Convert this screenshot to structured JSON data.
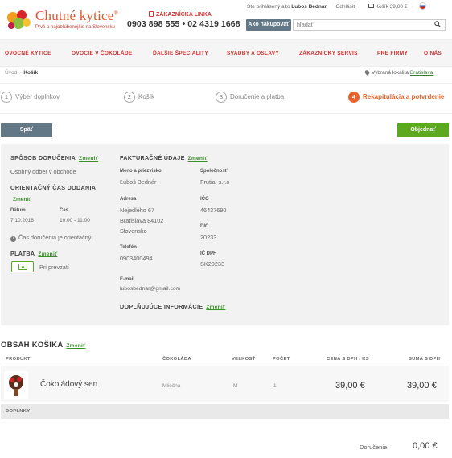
{
  "header": {
    "logo_name": "Chutné kytice",
    "logo_reg": "®",
    "logo_tagline": "Prvé a najobľúbenejšie na Slovensku",
    "hotline_label": "ZÁKAZNÍCKA LINKA",
    "hotline_number": "0903 898 555 • 02 4319 1668",
    "logged_in_prefix": "Ste prihlásený ako",
    "user_name": "Lubos Bednar",
    "logout": "Odhlásiť",
    "cart_label": "Košík 39,00 €",
    "shop_button": "Ako nakupovať",
    "search_placeholder": "hľadať"
  },
  "nav": {
    "items": [
      "OVOCNÉ KYTICE",
      "OVOCIE V ČOKOLÁDE",
      "ĎALŠIE ŠPECIALITY",
      "SVADBY A OSLAVY",
      "ZÁKAZNÍCKY SERVIS",
      "PRE FIRMY",
      "O NÁS"
    ]
  },
  "breadcrumb": {
    "home": "Úvod",
    "current": "Košík"
  },
  "location": {
    "label": "Vybraná lokalita",
    "city": "Bratislava"
  },
  "steps": [
    {
      "num": "1",
      "label": "Výber doplnkov"
    },
    {
      "num": "2",
      "label": "Košík"
    },
    {
      "num": "3",
      "label": "Doručenie a platba"
    },
    {
      "num": "4",
      "label": "Rekapitulácia a potvrdenie"
    }
  ],
  "buttons": {
    "back": "Späť",
    "order": "Objednať"
  },
  "summary": {
    "edit": "Zmeniť",
    "delivery_title": "SPÔSOB DORUČENIA",
    "delivery_value": "Osobný odber v obchode",
    "time_title": "ORIENTAČNÝ ČAS DODANIA",
    "date_label": "Dátum",
    "date_value": "7.10.2018",
    "time_label": "Čas",
    "time_value": "10:00 - 11:00",
    "time_note": "Čas doručenia je orientačný",
    "payment_title": "PLATBA",
    "payment_value": "Pri prevzatí",
    "billing_title": "FAKTURAČNÉ ÚDAJE",
    "name_label": "Meno a priezvisko",
    "name_value": "Ľuboš Bednár",
    "company_label": "Spoločnosť",
    "company_value": "Frutia, s.r.o",
    "address_label": "Adresa",
    "address_line1": "Nejedlého 67",
    "address_line2": "Bratislava 84102",
    "address_line3": "Slovensko",
    "ico_label": "IČO",
    "ico_value": "46437690",
    "dic_label": "DIČ",
    "dic_value": "20233",
    "phone_label": "Telefón",
    "phone_value": "0903400494",
    "icdph_label": "IČ DPH",
    "icdph_value": "SK20233",
    "email_label": "E-mail",
    "email_value": "lubosbednar@gmail.com",
    "extra_title": "DOPLŇUJÚCE INFORMÁCIE"
  },
  "cart": {
    "title": "OBSAH KOŠÍKA",
    "columns": [
      "PRODUKT",
      "ČOKOLÁDA",
      "VEĽKOSŤ",
      "POČET",
      "CENA S DPH / KS",
      "SUMA S DPH"
    ],
    "item": {
      "name": "Čokoládový sen",
      "chocolate": "Mliečna",
      "size": "M",
      "count": "1",
      "unit_price": "39,00 €",
      "total": "39,00 €"
    },
    "addons_label": "DOPLNKY",
    "delivery_label": "Doručenie",
    "delivery_value": "0,00 €"
  },
  "colors": {
    "brand_red": "#d1322f",
    "accent_orange": "#e8632d",
    "green": "#5ca81e",
    "slate": "#637886"
  }
}
